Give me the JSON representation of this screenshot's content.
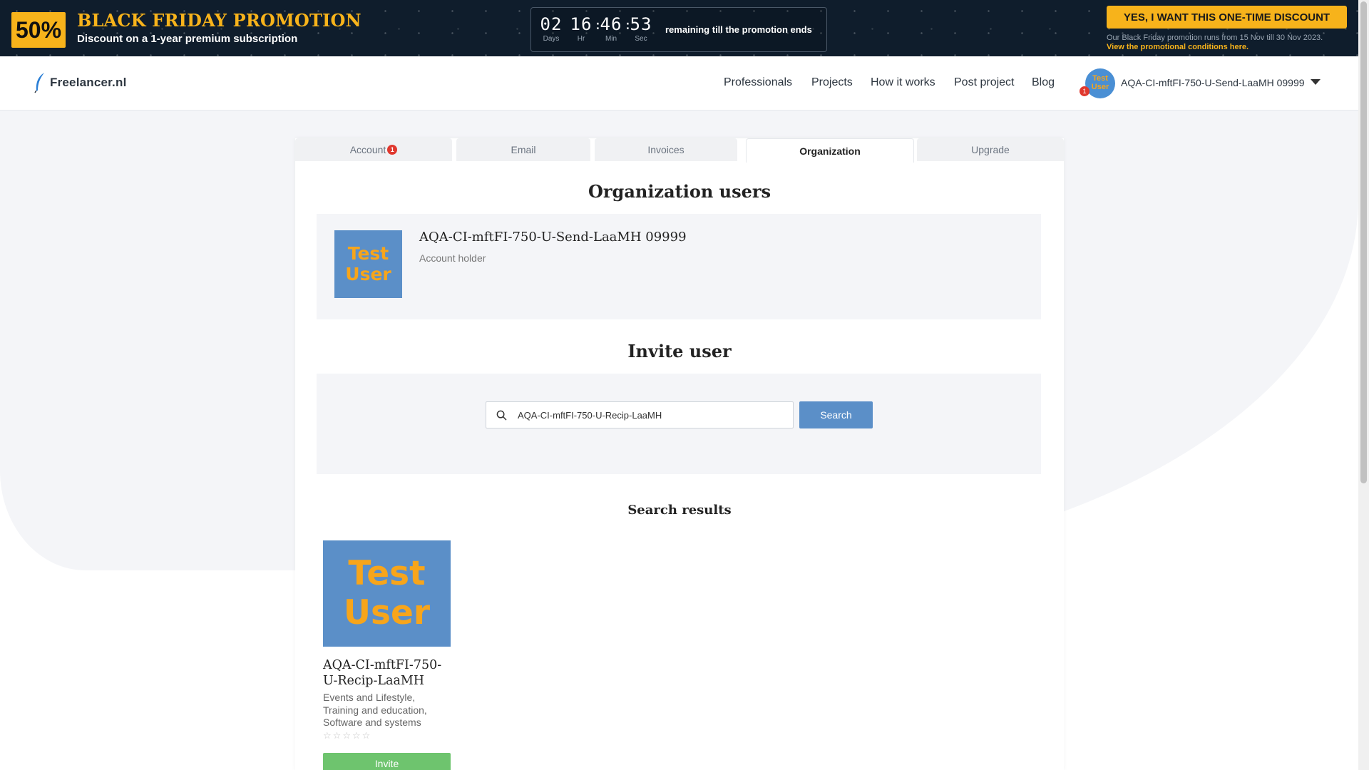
{
  "promo": {
    "badge": "50%",
    "title": "BLACK FRIDAY PROMOTION",
    "subtitle": "Discount on a 1-year premium subscription",
    "countdown": {
      "days": "02",
      "days_label": "Days",
      "hours": "16",
      "hours_label": "Hr",
      "minutes": "46",
      "minutes_label": "Min",
      "seconds": "53",
      "seconds_label": "Sec",
      "separator": ":",
      "text": "remaining till the promotion ends"
    },
    "cta_label": "YES, I WANT THIS ONE-TIME DISCOUNT",
    "note": "Our Black Friday promotion runs from 15 Nov till 30 Nov 2023.",
    "note_link": "View the promotional conditions here.",
    "accent_color": "#f7b31b"
  },
  "header": {
    "logo_text": "Freelancer.nl",
    "nav": [
      "Professionals",
      "Projects",
      "How it works",
      "Post project",
      "Blog"
    ],
    "user": {
      "avatar_text_1": "Test",
      "avatar_text_2": "User",
      "badge": "1",
      "name": "AQA-CI-mftFI-750-U-Send-LaaMH 09999"
    }
  },
  "tabs": [
    {
      "label": "Account",
      "badge": "1",
      "active": false
    },
    {
      "label": "Email",
      "active": false
    },
    {
      "label": "Invoices",
      "active": false
    },
    {
      "label": "Organization",
      "active": true
    },
    {
      "label": "Upgrade",
      "active": false
    }
  ],
  "org_users": {
    "heading": "Organization users",
    "user": {
      "avatar_text_1": "Test",
      "avatar_text_2": "User",
      "name": "AQA-CI-mftFI-750-U-Send-LaaMH 09999",
      "role": "Account holder"
    }
  },
  "invite": {
    "heading": "Invite user",
    "search_value": "AQA-CI-mftFI-750-U-Recip-LaaMH",
    "search_button": "Search"
  },
  "results": {
    "heading": "Search results",
    "items": [
      {
        "avatar_text_1": "Test",
        "avatar_text_2": "User",
        "name": "AQA-CI-mftFI-750-U-Recip-LaaMH",
        "categories": "Events and Lifestyle, Training and education, Software and systems",
        "rating": 0,
        "rating_max": 5,
        "invite_label": "Invite"
      }
    ]
  }
}
